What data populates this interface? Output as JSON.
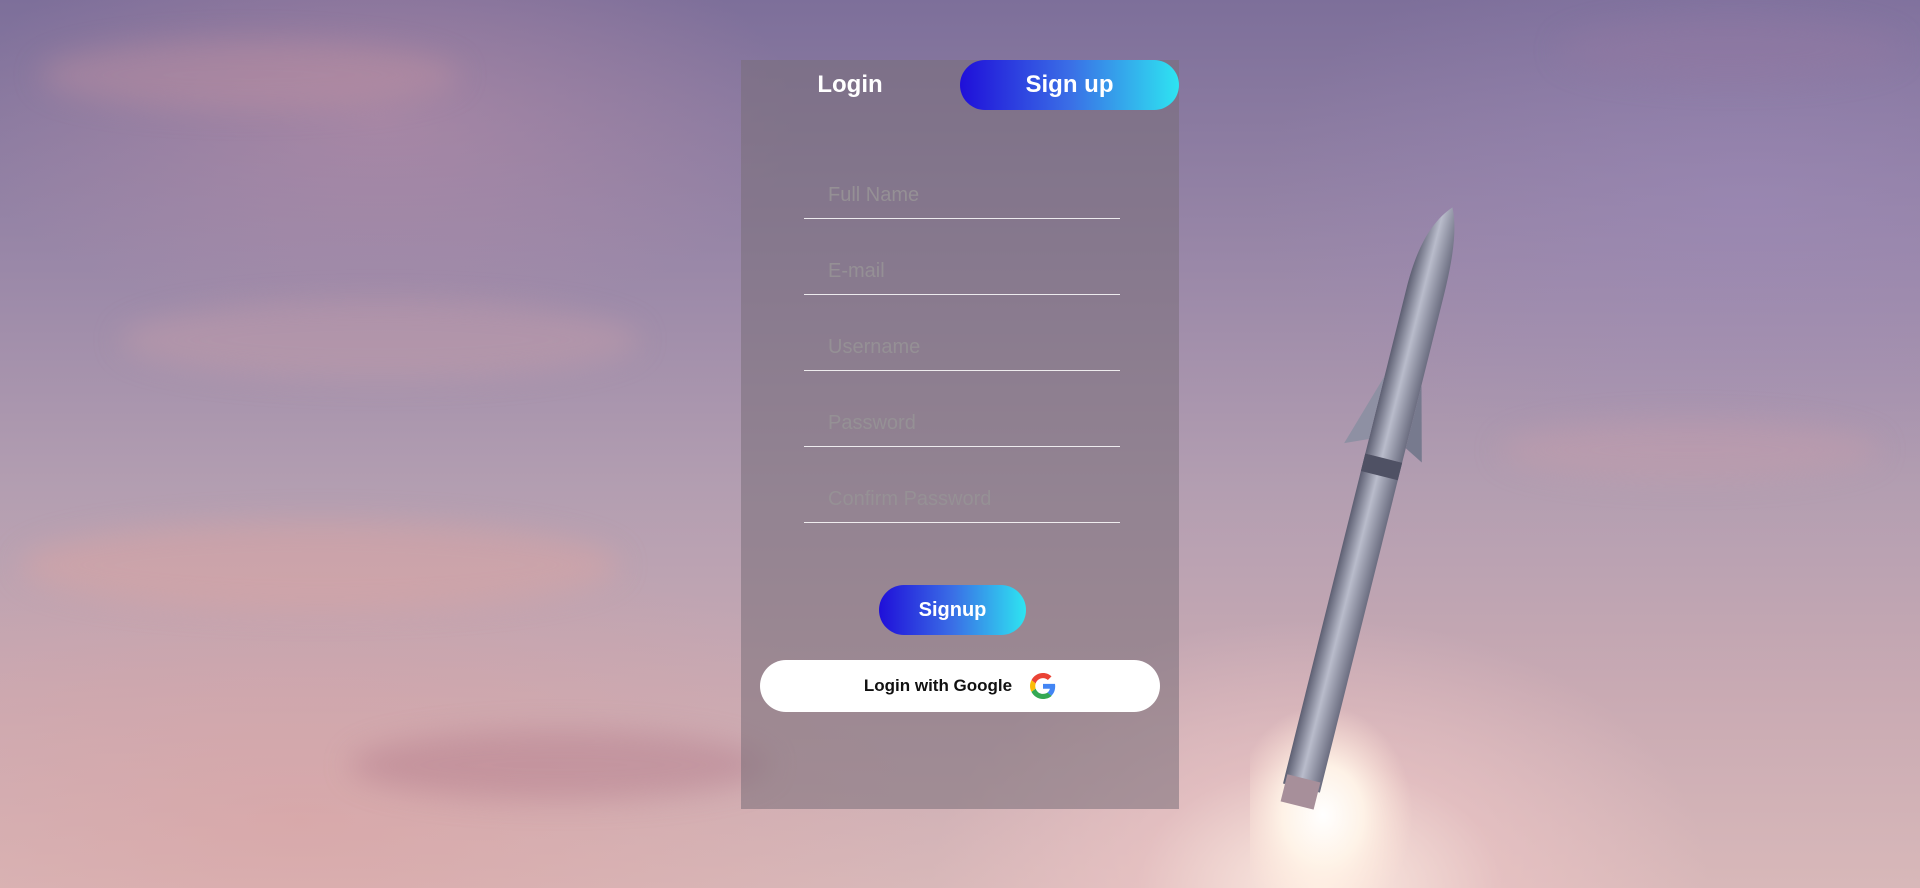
{
  "tabs": {
    "login_label": "Login",
    "signup_label": "Sign up",
    "active": "signup"
  },
  "form": {
    "full_name_placeholder": "Full Name",
    "email_placeholder": "E-mail",
    "username_placeholder": "Username",
    "password_placeholder": "Password",
    "confirm_password_placeholder": "Confirm Password"
  },
  "actions": {
    "signup_button_label": "Signup",
    "google_button_label": "Login with Google"
  },
  "icons": {
    "google": "google-icon"
  },
  "colors": {
    "accent_gradient_start": "#1f0fd9",
    "accent_gradient_end": "#2ee4f1",
    "panel_background": "rgba(120,110,120,0.55)",
    "google_button_background": "#ffffff"
  }
}
